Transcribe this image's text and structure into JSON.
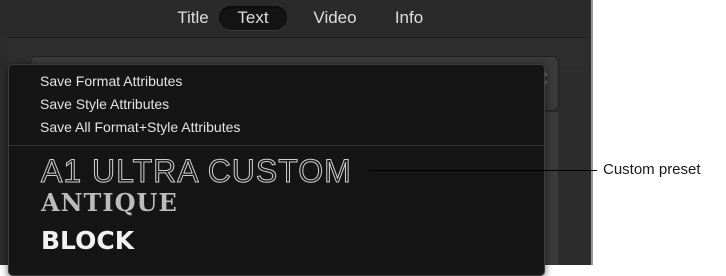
{
  "tabs": [
    {
      "label": "Title",
      "selected": false
    },
    {
      "label": "Text",
      "selected": true
    },
    {
      "label": "Video",
      "selected": false
    },
    {
      "label": "Info",
      "selected": false
    }
  ],
  "menu": {
    "items": [
      "Save Format Attributes",
      "Save Style Attributes",
      "Save All Format+Style Attributes"
    ],
    "presets": [
      "A1 ULTRA CUSTOM",
      "ANTIQUE",
      "BLOCK"
    ]
  },
  "callout": {
    "label": "Custom preset"
  },
  "colors": {
    "app_background": "#2c2c2c",
    "menu_background": "#151515",
    "text": "#e4e4e4"
  }
}
